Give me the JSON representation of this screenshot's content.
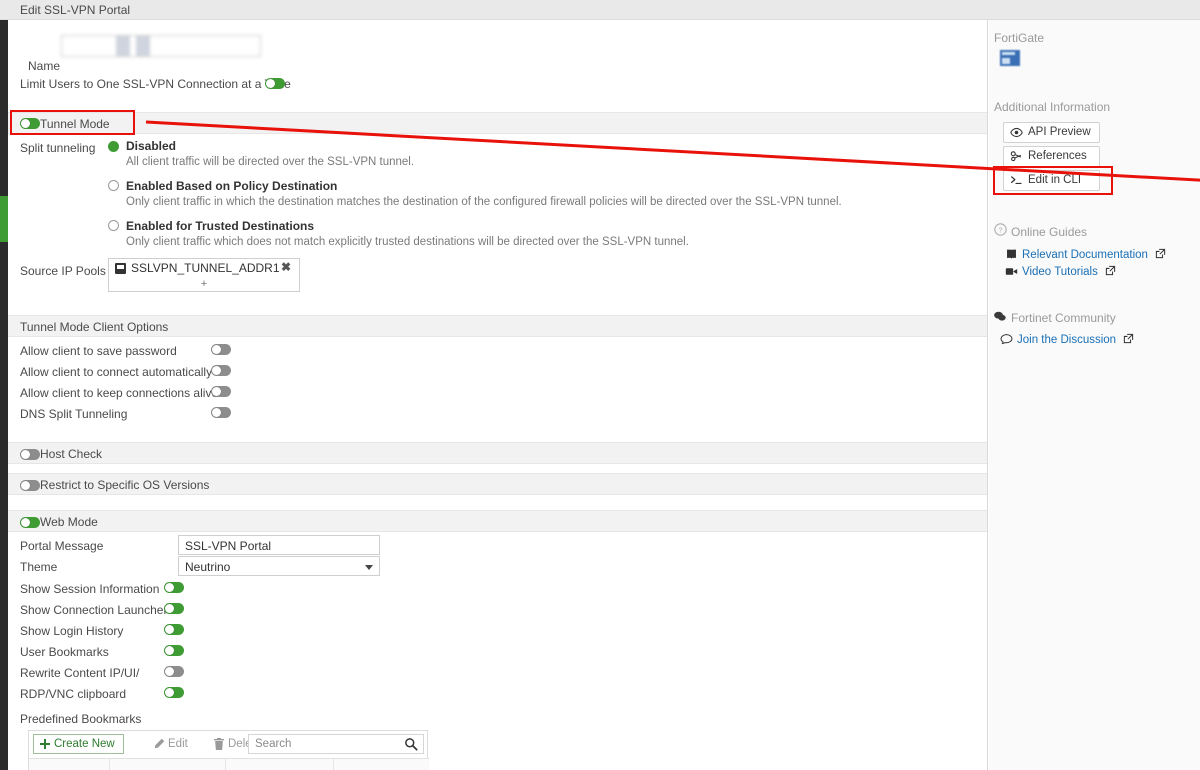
{
  "window": {
    "title": "Edit SSL-VPN Portal"
  },
  "form": {
    "name_label": "Name",
    "name_value": "",
    "name_placeholder": "",
    "limit_users_label": "Limit Users to One SSL-VPN Connection at a Time",
    "tunnel_mode_label": "Tunnel Mode",
    "split_tunneling_label": "Split tunneling",
    "split_options": [
      {
        "label": "Disabled",
        "desc": "All client traffic will be directed over the SSL-VPN tunnel.",
        "selected": true
      },
      {
        "label": "Enabled Based on Policy Destination",
        "desc": "Only client traffic in which the destination matches the destination of the configured firewall policies will be directed over the SSL-VPN tunnel.",
        "selected": false
      },
      {
        "label": "Enabled for Trusted Destinations",
        "desc": "Only client traffic which does not match explicitly trusted destinations will be directed over the SSL-VPN tunnel.",
        "selected": false
      }
    ],
    "source_ip_pools_label": "Source IP Pools",
    "source_ip_pools_values": [
      "SSLVPN_TUNNEL_ADDR1"
    ],
    "source_ip_pools_add": "+",
    "source_ip_pools_remove": "✖",
    "tunnel_client_options_label": "Tunnel Mode Client Options",
    "tunnel_client_options": [
      {
        "label": "Allow client to save password",
        "state": "off"
      },
      {
        "label": "Allow client to connect automatically",
        "state": "off"
      },
      {
        "label": "Allow client to keep connections alive",
        "state": "off"
      },
      {
        "label": "DNS Split Tunneling",
        "state": "off"
      }
    ],
    "host_check_label": "Host Check",
    "restrict_os_label": "Restrict to Specific OS Versions",
    "web_mode_label": "Web Mode",
    "portal_message_label": "Portal Message",
    "portal_message_value": "SSL-VPN Portal",
    "theme_label": "Theme",
    "theme_value": "Neutrino",
    "theme_options": [
      "Neutrino"
    ],
    "web_mode_options": [
      {
        "label": "Show Session Information",
        "state": "on"
      },
      {
        "label": "Show Connection Launcher",
        "state": "on"
      },
      {
        "label": "Show Login History",
        "state": "on"
      },
      {
        "label": "User Bookmarks",
        "state": "on"
      },
      {
        "label": "Rewrite Content IP/UI/",
        "state": "off"
      },
      {
        "label": "RDP/VNC clipboard",
        "state": "on"
      }
    ],
    "predefined_bookmarks_label": "Predefined Bookmarks",
    "toolbar": {
      "create_new": "Create New",
      "edit": "Edit",
      "delete": "Delete",
      "search_placeholder": "Search",
      "search_value": ""
    }
  },
  "sidebar": {
    "product_heading": "FortiGate",
    "additional_info_heading": "Additional Information",
    "buttons": [
      {
        "label": "API Preview",
        "icon": "eye-icon"
      },
      {
        "label": "References",
        "icon": "link-icon"
      },
      {
        "label": "Edit in CLI",
        "icon": "terminal-icon"
      }
    ],
    "online_guides_heading": "Online Guides",
    "guides": [
      {
        "label": "Relevant Documentation",
        "icon": "book-icon"
      },
      {
        "label": "Video Tutorials",
        "icon": "video-icon"
      }
    ],
    "community_heading": "Fortinet Community",
    "community_links": [
      {
        "label": "Join the Discussion",
        "icon": "chat-icon"
      }
    ]
  },
  "annotations": {
    "highlight_color": "#e8120b",
    "highlight_targets": [
      "tunnel-mode-row",
      "edit-in-cli-button"
    ],
    "arrow_from": "tunnel-mode-row",
    "arrow_to": "edit-in-cli-button"
  },
  "colors": {
    "toggle_on": "#3f9c35",
    "toggle_off": "#8d8d8d",
    "link": "#1a6fb5",
    "band": "#f2f2f2",
    "rail": "#2b2b2b",
    "accent": "#3f9c35"
  }
}
